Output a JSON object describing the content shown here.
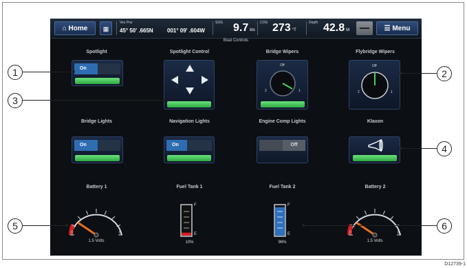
{
  "topbar": {
    "home_label": "Home",
    "home_icon": "home-icon",
    "grid_icon": "grid-icon",
    "ves_pos_label": "Ves Pos",
    "latitude": "45° 50' .665N",
    "longitude": "001° 09' .604W",
    "sog_label": "SOG",
    "sog_value": "9.7",
    "sog_unit": "kts",
    "cog_label": "COG",
    "cog_value": "273",
    "cog_unit": "°T",
    "depth_label": "Depth",
    "depth_value": "42.8",
    "depth_unit": "M",
    "menu_label": "Menu",
    "menu_icon": "menu-icon"
  },
  "subtitle": "Boat Controls",
  "tiles": {
    "spotlight": {
      "label": "Spotlight",
      "state": "On"
    },
    "spotlight_control": {
      "label": "Spotlight Control"
    },
    "bridge_wipers": {
      "label": "Bridge Wipers",
      "off": "Off",
      "pos2": "2",
      "pos1": "1"
    },
    "flybridge_wipers": {
      "label": "Flybridge Wipers",
      "off": "Off",
      "pos2": "2",
      "pos1": "1"
    },
    "bridge_lights": {
      "label": "Bridge Lights",
      "state": "On"
    },
    "navigation_lights": {
      "label": "Navigation Lights",
      "state": "On"
    },
    "engine_comp_lights": {
      "label": "Engine Comp Lights",
      "state": "Off"
    },
    "klaxon": {
      "label": "Klaxon",
      "icon": "horn-icon"
    },
    "battery1": {
      "label": "Battery 1",
      "reading": "1.5 Volts",
      "min": "0",
      "max": "8",
      "value": 1.5
    },
    "fuel_tank1": {
      "label": "Fuel Tank 1",
      "reading": "10%",
      "full": "F",
      "empty": "E",
      "level": 0.1
    },
    "fuel_tank2": {
      "label": "Fuel Tank 2",
      "reading": "96%",
      "full": "F",
      "empty": "E",
      "level": 0.96
    },
    "battery2": {
      "label": "Battery 2",
      "reading": "1.5 Volts",
      "min": "0",
      "max": "8",
      "value": 1.5
    }
  },
  "callouts": [
    "1",
    "2",
    "3",
    "4",
    "5",
    "6"
  ],
  "figure_code": "D12739-1",
  "colors": {
    "accent_green": "#3fbf55",
    "toggle_on": "#2f6db2",
    "needle": "#e8701c",
    "danger": "#d42020"
  }
}
